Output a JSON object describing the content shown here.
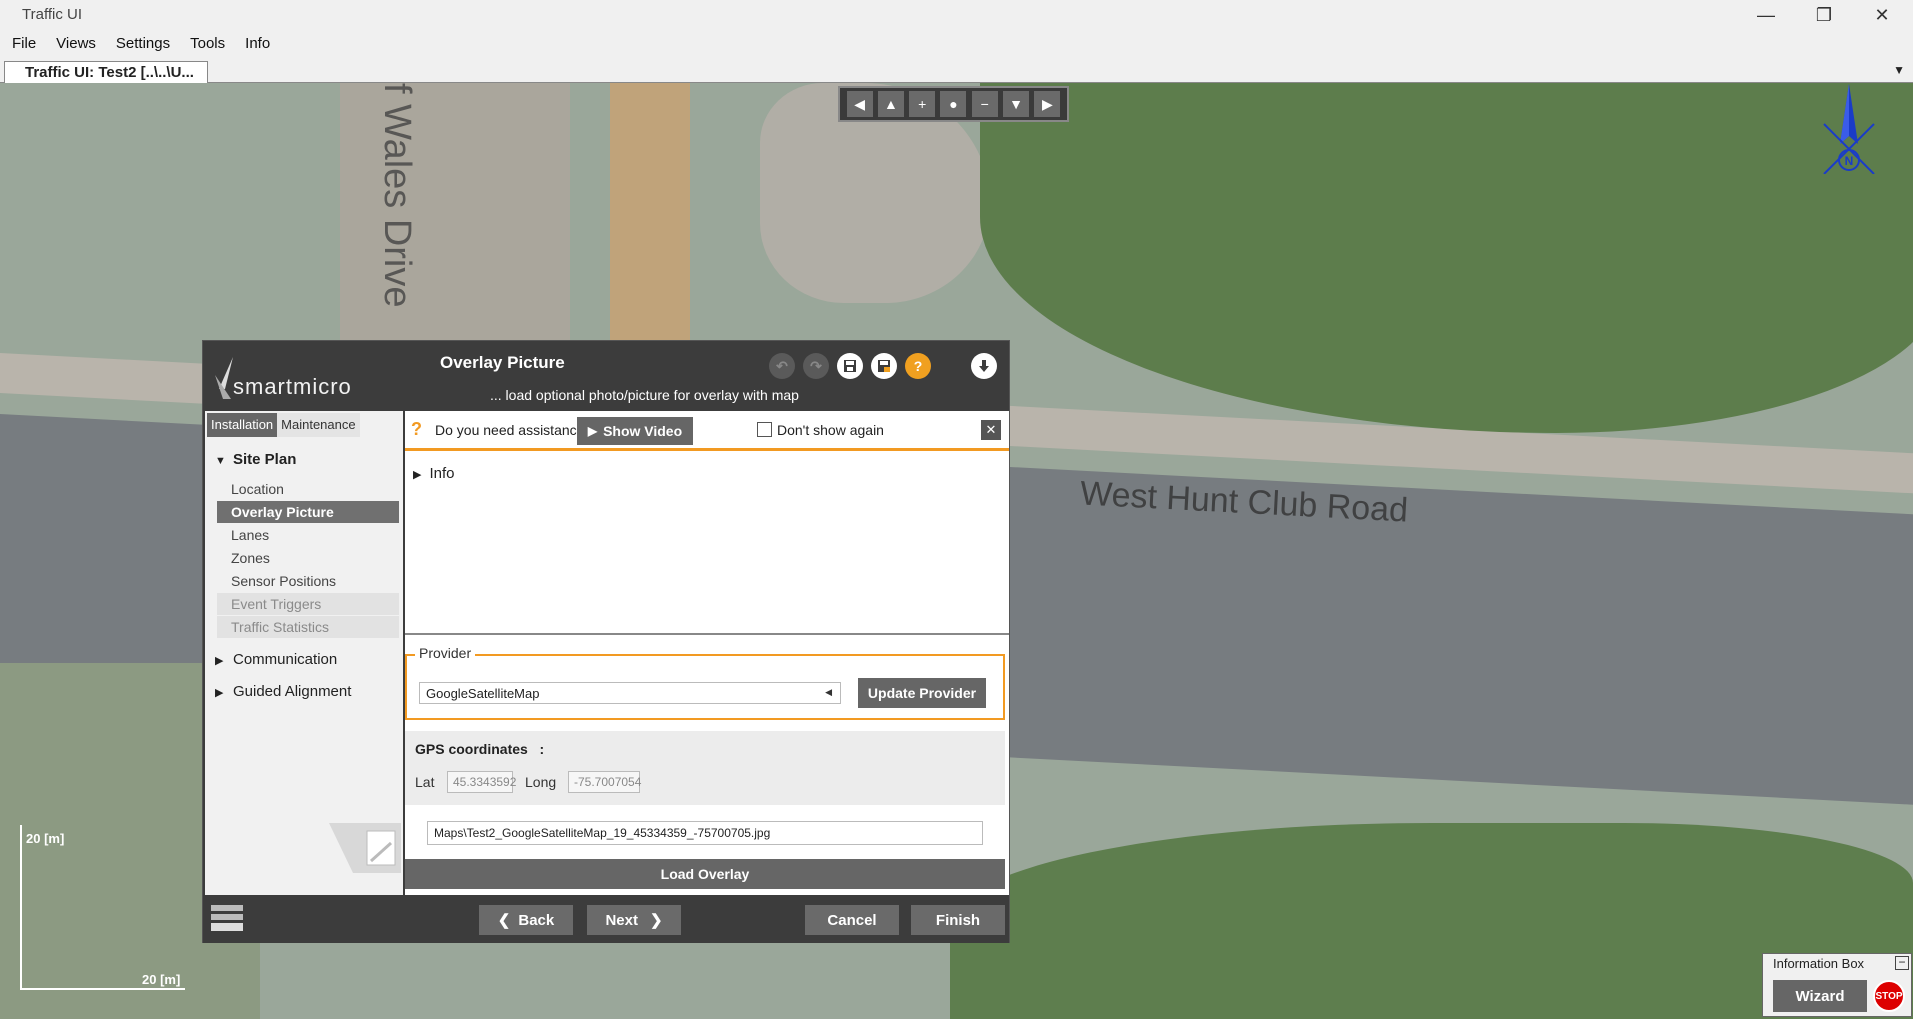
{
  "window": {
    "title": "Traffic UI",
    "minimize_glyph": "—",
    "restore_glyph": "❐",
    "close_glyph": "✕"
  },
  "menu": [
    "File",
    "Views",
    "Settings",
    "Tools",
    "Info"
  ],
  "tab": {
    "label": "Traffic UI: Test2 [..\\..\\U...",
    "dropdown_glyph": "▼"
  },
  "map": {
    "road_label": "West Hunt Club Road",
    "street_label": "f Wales Drive",
    "compass_letter": "N",
    "scale_v": "20 [m]",
    "scale_h": "20 [m]",
    "nav_controls": [
      "◀",
      "▲",
      "+",
      "●",
      "−",
      "▼",
      "▶"
    ]
  },
  "dialog": {
    "logo_text": "smartmicro",
    "title": "Overlay Picture",
    "subtitle": "... load optional photo/picture for overlay with map",
    "header_icons": [
      "undo-icon",
      "redo-icon",
      "save-icon",
      "save-as-icon",
      "help-icon",
      "download-icon"
    ],
    "sidebar": {
      "tabs": [
        "Installation",
        "Maintenance"
      ],
      "site_plan": "Site Plan",
      "items": [
        "Location",
        "Overlay Picture",
        "Lanes",
        "Zones",
        "Sensor Positions",
        "Event Triggers",
        "Traffic Statistics"
      ],
      "communication": "Communication",
      "guided_alignment": "Guided Alignment"
    },
    "assist": {
      "question_mark": "?",
      "text": "Do you need assistance?",
      "show_video": "Show Video",
      "dont_show": "Don't show again",
      "close": "✕"
    },
    "info_label": "Info",
    "provider": {
      "legend": "Provider",
      "selected": "GoogleSatelliteMap",
      "update_button": "Update Provider"
    },
    "gps": {
      "title": "GPS coordinates",
      "colon": ":",
      "lat_label": "Lat",
      "lat_value": "45.3343592",
      "long_label": "Long",
      "long_value": "-75.7007054"
    },
    "file_path": "Maps\\Test2_GoogleSatelliteMap_19_45334359_-75700705.jpg",
    "load_overlay": "Load Overlay",
    "footer": {
      "back": "Back",
      "next": "Next",
      "cancel": "Cancel",
      "finish": "Finish"
    }
  },
  "info_box": {
    "title": "Information Box",
    "minimize": "−",
    "wizard": "Wizard",
    "stop": "STOP"
  },
  "colors": {
    "accent": "#f29a22",
    "dialog_bg": "#3c3c3c",
    "button_gray": "#666666",
    "stop_red": "#dd0000",
    "compass_blue": "#1a3cc8"
  }
}
